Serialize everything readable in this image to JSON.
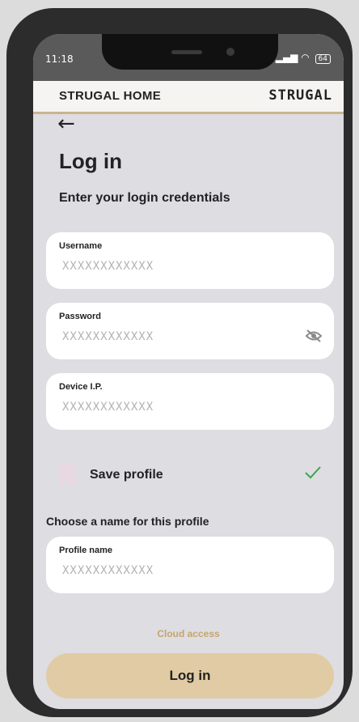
{
  "status_bar": {
    "time": "11:18",
    "battery": "64"
  },
  "app_bar": {
    "title": "STRUGAL HOME",
    "brand": "STRUGAL"
  },
  "page": {
    "title": "Log in",
    "subtitle": "Enter your login credentials"
  },
  "fields": {
    "username": {
      "label": "Username",
      "value": "XXXXXXXXXXXX"
    },
    "password": {
      "label": "Password",
      "value": "XXXXXXXXXXXX"
    },
    "device_ip": {
      "label": "Device I.P.",
      "value": "XXXXXXXXXXXX"
    },
    "profile_name": {
      "label": "Profile name",
      "value": "XXXXXXXXXXXX"
    }
  },
  "save_profile": {
    "label": "Save profile",
    "checked": true
  },
  "profile_heading": "Choose a name for this profile",
  "cloud_access": "Cloud access",
  "login_button": "Log in",
  "colors": {
    "accent": "#c9b48e",
    "button": "#e0cba4",
    "check": "#3aa64a",
    "link": "#c7a56b"
  }
}
